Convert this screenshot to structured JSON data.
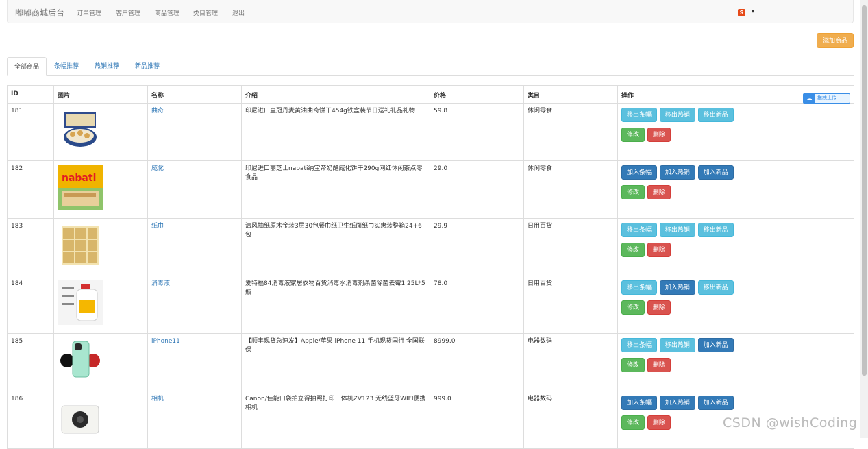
{
  "navbar": {
    "brand": "嘟嘟商城后台",
    "items": [
      "订单管理",
      "客户管理",
      "商品管理",
      "类目管理",
      "退出"
    ]
  },
  "add_button": "添加商品",
  "tabs": [
    "全部商品",
    "条幅推荐",
    "热销推荐",
    "新品推荐"
  ],
  "upload_tag": "拖拽上传",
  "table": {
    "headers": [
      "ID",
      "图片",
      "名称",
      "介绍",
      "价格",
      "类目",
      "操作"
    ],
    "rows": [
      {
        "id": "181",
        "name": "曲奇",
        "intro": "印尼进口皇冠丹麦黄油曲奇饼干454g铁盒装节日送礼礼品礼物",
        "price": "59.8",
        "category": "休闲零食",
        "actions": [
          "移出条幅",
          "移出热销",
          "移出新品"
        ],
        "action_styles": [
          "info",
          "info",
          "info"
        ],
        "image": "cookie-tin"
      },
      {
        "id": "182",
        "name": "威化",
        "intro": "印尼进口丽芝士nabati纳宝帝奶酪威化饼干290g网红休闲茶点零食品",
        "price": "29.0",
        "category": "休闲零食",
        "actions": [
          "加入条幅",
          "加入热销",
          "加入新品"
        ],
        "action_styles": [
          "primary",
          "primary",
          "primary"
        ],
        "image": "wafer"
      },
      {
        "id": "183",
        "name": "纸巾",
        "intro": "清风抽纸原木金装3层30包餐巾纸卫生纸面纸巾实惠装整箱24+6包",
        "price": "29.9",
        "category": "日用百货",
        "actions": [
          "移出条幅",
          "移出热销",
          "移出新品"
        ],
        "action_styles": [
          "info",
          "info",
          "info"
        ],
        "image": "tissue"
      },
      {
        "id": "184",
        "name": "消毒液",
        "intro": "爱特福84消毒液家居衣物百货消毒水消毒剂杀菌除菌去霉1.25L*5瓶",
        "price": "78.0",
        "category": "日用百货",
        "actions": [
          "移出条幅",
          "加入热销",
          "移出新品"
        ],
        "action_styles": [
          "info",
          "primary",
          "info"
        ],
        "image": "disinfectant"
      },
      {
        "id": "185",
        "name": "iPhone11",
        "intro": "【顺丰现货急速发】Apple/苹果 iPhone 11 手机现货国行 全国联保",
        "price": "8999.0",
        "category": "电器数码",
        "actions": [
          "移出条幅",
          "移出热销",
          "加入新品"
        ],
        "action_styles": [
          "info",
          "info",
          "primary"
        ],
        "image": "iphone"
      },
      {
        "id": "186",
        "name": "相机",
        "intro": "Canon/佳能口袋拍立得拍照打印一体机ZV123 无线蓝牙WIFI便携相机",
        "price": "999.0",
        "category": "电器数码",
        "actions": [
          "加入条幅",
          "加入热销",
          "加入新品"
        ],
        "action_styles": [
          "primary",
          "primary",
          "primary"
        ],
        "image": "camera"
      }
    ],
    "edit_label": "修改",
    "delete_label": "删除"
  },
  "watermark": "CSDN @wishCoding"
}
